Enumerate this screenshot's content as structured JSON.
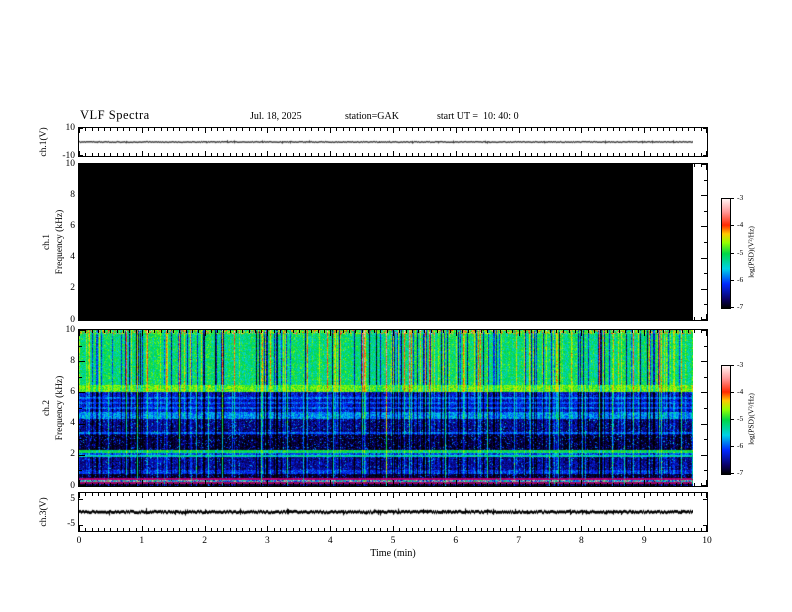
{
  "title": {
    "main": "VLF Spectra",
    "date": "Jul. 18, 2025",
    "station": "station=GAK",
    "start": "start UT =  10: 40: 0"
  },
  "time_axis": {
    "label": "Time (min)",
    "ticks": [
      "0",
      "1",
      "2",
      "3",
      "4",
      "5",
      "6",
      "7",
      "8",
      "9",
      "10"
    ],
    "min": 0,
    "max": 10,
    "major_step": 1,
    "minor_step": 0.1,
    "data_end_min": 9.78
  },
  "colorbar": {
    "label": "log(PSD)(V²/Hz)",
    "ticks": [
      "-3",
      "-4",
      "-5",
      "-6",
      "-7"
    ],
    "zmin": -7,
    "zmax": -3,
    "stops": [
      {
        "t": 0.0,
        "rgb": [
          0,
          0,
          0
        ]
      },
      {
        "t": 0.08,
        "rgb": [
          10,
          0,
          100
        ]
      },
      {
        "t": 0.22,
        "rgb": [
          0,
          40,
          255
        ]
      },
      {
        "t": 0.36,
        "rgb": [
          0,
          210,
          230
        ]
      },
      {
        "t": 0.5,
        "rgb": [
          0,
          215,
          70
        ]
      },
      {
        "t": 0.6,
        "rgb": [
          150,
          255,
          0
        ]
      },
      {
        "t": 0.68,
        "rgb": [
          255,
          200,
          0
        ]
      },
      {
        "t": 0.76,
        "rgb": [
          255,
          40,
          0
        ]
      },
      {
        "t": 0.88,
        "rgb": [
          255,
          150,
          150
        ]
      },
      {
        "t": 1.0,
        "rgb": [
          255,
          243,
          243
        ]
      }
    ]
  },
  "panels": {
    "ch1v": {
      "ylabel": "ch.1(V)",
      "yticks": [
        "10",
        "-10"
      ],
      "ylim": [
        -10,
        10
      ]
    },
    "spec1": {
      "ylabel_channel": "ch.1",
      "ylabel_axis": "Frequency (kHz)",
      "yticks": [
        "0",
        "2",
        "4",
        "6",
        "8",
        "10"
      ],
      "ylim": [
        0,
        10
      ]
    },
    "spec2": {
      "ylabel_channel": "ch.2",
      "ylabel_axis": "Frequency (kHz)",
      "yticks": [
        "0",
        "2",
        "4",
        "6",
        "8",
        "10"
      ],
      "ylim": [
        0,
        10
      ]
    },
    "ch3v": {
      "ylabel": "ch.3(V)",
      "yticks": [
        "5",
        "-5"
      ],
      "ylim": [
        -7.5,
        7.5
      ]
    }
  },
  "chart_data": [
    {
      "type": "line",
      "name": "ch.1 voltage strip",
      "ylabel": "ch.1(V)",
      "ylim": [
        -10,
        10
      ],
      "xlim": [
        0,
        10
      ],
      "x_end": 9.78,
      "y_value": 0,
      "line_color": "#3a3a3a",
      "line_width": 1.5,
      "noise_amp": 0.4,
      "description": "flat trace at 0 V for the entire record"
    },
    {
      "type": "heatmap",
      "name": "ch.1 spectrogram",
      "ylabel": "ch.1 Frequency (kHz)",
      "ylim": [
        0,
        10
      ],
      "xlim": [
        0,
        10
      ],
      "x_end": 9.78,
      "zlabel": "log(PSD)(V²/Hz)",
      "zlim": [
        -7,
        -3
      ],
      "bands": [
        {
          "f_low": 0,
          "f_high": 10.01,
          "level": -7,
          "noise": 0,
          "streak": 0,
          "sferic": 0,
          "note": "no signal; entire panel at -7 floor (black)"
        }
      ]
    },
    {
      "type": "heatmap",
      "name": "ch.2 spectrogram",
      "ylabel": "ch.2 Frequency (kHz)",
      "ylim": [
        0,
        10
      ],
      "xlim": [
        0,
        10
      ],
      "x_end": 9.78,
      "zlabel": "log(PSD)(V²/Hz)",
      "zlim": [
        -7,
        -3
      ],
      "column_streaks": {
        "dark_p": 0.15,
        "dark_amp": 1.35,
        "bright_p": 0.12,
        "bright_amp": 0.55,
        "hot_p": 0.04,
        "hot_amp": 1.15,
        "sferic_p": 0.06,
        "sferic_amp": 1.0
      },
      "bands": [
        {
          "f_low": 9.75,
          "f_high": 10.01,
          "level": -4.95,
          "noise": 0.4,
          "streak": 1.0,
          "sferic": 0.2,
          "speckle": {
            "p": 0.2,
            "boost": 1.0
          }
        },
        {
          "f_low": 6.5,
          "f_high": 9.75,
          "level": -5.15,
          "noise": 0.3,
          "streak": 1.0,
          "sferic": 0.2
        },
        {
          "f_low": 6.05,
          "f_high": 6.5,
          "level": -4.75,
          "noise": 0.25,
          "streak": 0.5,
          "sferic": 0.3
        },
        {
          "f_low": 5.62,
          "f_high": 5.74,
          "level": -5.9,
          "noise": 0.25,
          "streak": 0.5,
          "sferic": 0.6
        },
        {
          "f_low": 5.3,
          "f_high": 5.42,
          "level": -6.0,
          "noise": 0.25,
          "streak": 0.5,
          "sferic": 0.6
        },
        {
          "f_low": 4.98,
          "f_high": 5.1,
          "level": -5.95,
          "noise": 0.25,
          "streak": 0.5,
          "sferic": 0.6
        },
        {
          "f_low": 4.75,
          "f_high": 6.05,
          "level": -6.35,
          "noise": 0.3,
          "streak": 0.9,
          "sferic": 1.0
        },
        {
          "f_low": 4.35,
          "f_high": 4.75,
          "level": -5.8,
          "noise": 0.3,
          "streak": 0.7,
          "sferic": 0.6
        },
        {
          "f_low": 3.38,
          "f_high": 3.52,
          "level": -5.95,
          "noise": 0.25,
          "streak": 0.5,
          "sferic": 0.6
        },
        {
          "f_low": 3.3,
          "f_high": 4.35,
          "level": -6.6,
          "noise": 0.25,
          "streak": 0.8,
          "sferic": 1.0,
          "speckle": {
            "p": 0.1,
            "boost": 0.7
          }
        },
        {
          "f_low": 2.35,
          "f_high": 3.3,
          "level": -6.85,
          "noise": 0.18,
          "streak": 0.5,
          "sferic": 1.0,
          "speckle": {
            "p": 0.13,
            "boost": 0.8
          }
        },
        {
          "f_low": 2.16,
          "f_high": 2.35,
          "level": -5.05,
          "noise": 0.2,
          "streak": 0.3,
          "sferic": 0.2
        },
        {
          "f_low": 2.0,
          "f_high": 2.16,
          "level": -6.0,
          "noise": 0.3,
          "streak": 0.4,
          "sferic": 0.6
        },
        {
          "f_low": 1.86,
          "f_high": 2.0,
          "level": -5.35,
          "noise": 0.25,
          "streak": 0.3,
          "sferic": 0.3
        },
        {
          "f_low": 1.05,
          "f_high": 1.86,
          "level": -6.55,
          "noise": 0.25,
          "streak": 0.6,
          "sferic": 1.0,
          "speckle": {
            "p": 0.1,
            "boost": 0.6
          }
        },
        {
          "f_low": 0.8,
          "f_high": 1.05,
          "level": -6.15,
          "noise": 0.3,
          "streak": 0.6,
          "sferic": 0.8
        },
        {
          "f_low": 0.55,
          "f_high": 0.8,
          "level": -6.85,
          "noise": 0.15,
          "streak": 0.4,
          "sferic": 1.0,
          "speckle": {
            "p": 0.12,
            "boost": 0.7
          }
        },
        {
          "f_low": 0.44,
          "f_high": 0.55,
          "level": -3.55,
          "noise": 0.1,
          "streak": 0.1,
          "sferic": 0.1,
          "color": [
            178,
            0,
            112
          ]
        },
        {
          "f_low": 0.28,
          "f_high": 0.44,
          "level": -5.75,
          "noise": 0.55,
          "streak": 0.4,
          "sferic": 0.5,
          "palette": "gray-green"
        },
        {
          "f_low": 0.16,
          "f_high": 0.28,
          "level": -3.6,
          "noise": 0.1,
          "streak": 0.1,
          "sferic": 0.1,
          "color": [
            152,
            0,
            96
          ]
        },
        {
          "f_low": 0.0,
          "f_high": 0.16,
          "level": -6.85,
          "noise": 0.15,
          "streak": 0.3,
          "sferic": 0.8,
          "speckle": {
            "p": 0.1,
            "boost": 0.5
          }
        }
      ]
    },
    {
      "type": "line",
      "name": "ch.3 voltage strip",
      "ylabel": "ch.3(V)",
      "ylim": [
        -7.5,
        7.5
      ],
      "xlim": [
        0,
        10
      ],
      "x_end": 9.78,
      "y_value": 0,
      "line_color": "#000000",
      "line_width": 2.8,
      "noise_amp": 0.9,
      "description": "flat thick noisy trace at 0 V"
    }
  ]
}
